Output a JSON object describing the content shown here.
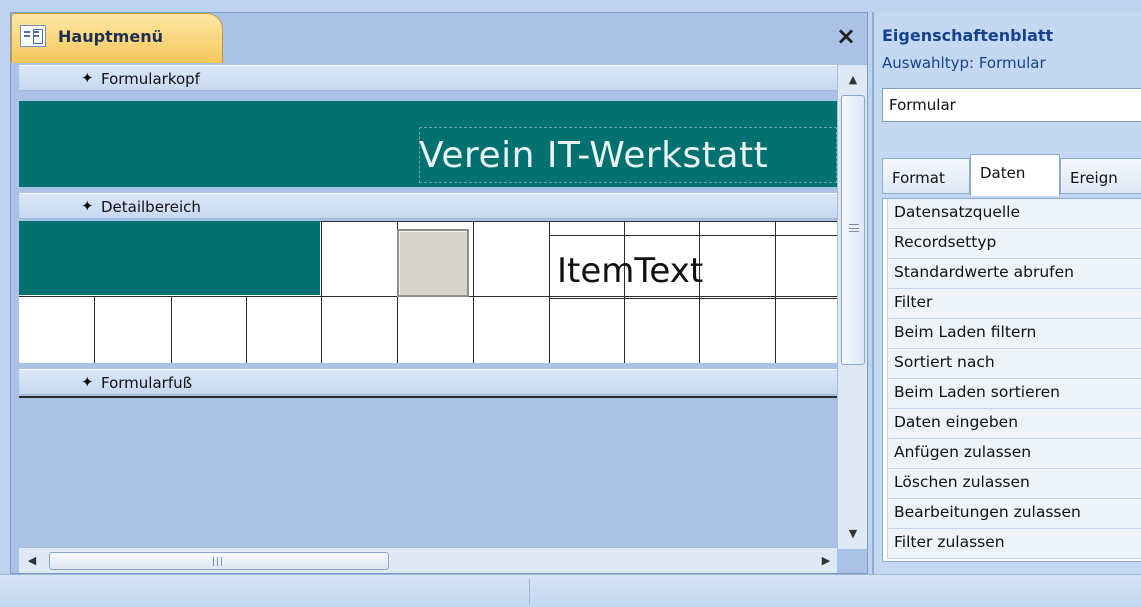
{
  "document": {
    "tab_title": "Hauptmenü",
    "close_glyph": "×"
  },
  "sections": {
    "header": "Formularkopf",
    "detail": "Detailbereich",
    "footer": "Formularfuß",
    "marker_glyph": "✦"
  },
  "form_header": {
    "title": "Verein IT-Werkstatt"
  },
  "detail": {
    "item_text": "ItemText"
  },
  "property_sheet": {
    "title": "Eigenschaftenblatt",
    "selection_type": "Auswahltyp:  Formular",
    "selected_object": "Formular",
    "tabs": [
      "Format",
      "Daten",
      "Ereign"
    ],
    "active_tab": "Daten",
    "properties": [
      "Datensatzquelle",
      "Recordsettyp",
      "Standardwerte abrufen",
      "Filter",
      "Beim Laden filtern",
      "Sortiert nach",
      "Beim Laden sortieren",
      "Daten eingeben",
      "Anfügen zulassen",
      "Löschen zulassen",
      "Bearbeitungen zulassen",
      "Filter zulassen"
    ]
  },
  "scroll": {
    "up": "▲",
    "down": "▼",
    "left": "◀",
    "right": "▶"
  },
  "colors": {
    "section_fill": "#037170",
    "accent_tab": "#f6c75a",
    "title_blue": "#15428b"
  }
}
